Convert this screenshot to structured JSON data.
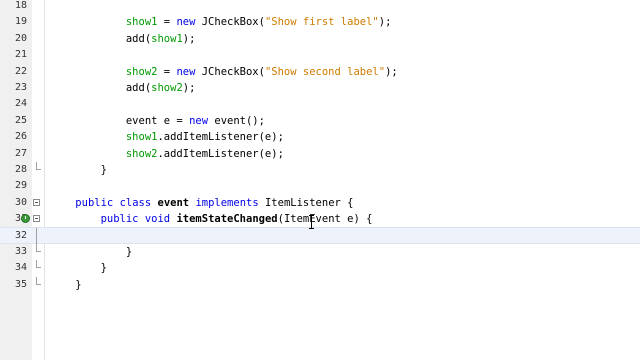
{
  "editor": {
    "lines": [
      {
        "num": "18",
        "indent": "",
        "tokens": [],
        "fold": "line"
      },
      {
        "num": "19",
        "indent": "            ",
        "fold": "line",
        "tokens": [
          {
            "t": "show1",
            "c": "fld"
          },
          {
            "t": " = "
          },
          {
            "t": "new",
            "c": "kw"
          },
          {
            "t": " JCheckBox("
          },
          {
            "t": "\"Show first label\"",
            "c": "str"
          },
          {
            "t": ");"
          }
        ]
      },
      {
        "num": "20",
        "indent": "            ",
        "fold": "line",
        "tokens": [
          {
            "t": "add("
          },
          {
            "t": "show1",
            "c": "fld"
          },
          {
            "t": ");"
          }
        ]
      },
      {
        "num": "21",
        "indent": "",
        "fold": "line",
        "tokens": []
      },
      {
        "num": "22",
        "indent": "            ",
        "fold": "line",
        "tokens": [
          {
            "t": "show2",
            "c": "fld"
          },
          {
            "t": " = "
          },
          {
            "t": "new",
            "c": "kw"
          },
          {
            "t": " JCheckBox("
          },
          {
            "t": "\"Show second label\"",
            "c": "str"
          },
          {
            "t": ");"
          }
        ]
      },
      {
        "num": "23",
        "indent": "            ",
        "fold": "line",
        "tokens": [
          {
            "t": "add("
          },
          {
            "t": "show2",
            "c": "fld"
          },
          {
            "t": ");"
          }
        ]
      },
      {
        "num": "24",
        "indent": "",
        "fold": "line",
        "tokens": []
      },
      {
        "num": "25",
        "indent": "            ",
        "fold": "line",
        "tokens": [
          {
            "t": "event e = "
          },
          {
            "t": "new",
            "c": "kw"
          },
          {
            "t": " event();"
          }
        ]
      },
      {
        "num": "26",
        "indent": "            ",
        "fold": "line",
        "tokens": [
          {
            "t": "show1",
            "c": "fld"
          },
          {
            "t": ".addItemListener(e);"
          }
        ]
      },
      {
        "num": "27",
        "indent": "            ",
        "fold": "line",
        "tokens": [
          {
            "t": "show2",
            "c": "fld"
          },
          {
            "t": ".addItemListener(e);"
          }
        ]
      },
      {
        "num": "28",
        "indent": "        ",
        "fold": "end",
        "tokens": [
          {
            "t": "}"
          }
        ]
      },
      {
        "num": "29",
        "indent": "",
        "fold": "line",
        "tokens": []
      },
      {
        "num": "30",
        "indent": "    ",
        "fold": "toggle",
        "tokens": [
          {
            "t": "public",
            "c": "kw"
          },
          {
            "t": " "
          },
          {
            "t": "class",
            "c": "kw"
          },
          {
            "t": " "
          },
          {
            "t": "event",
            "c": "bold"
          },
          {
            "t": " "
          },
          {
            "t": "implements",
            "c": "kw"
          },
          {
            "t": " ItemListener {"
          }
        ]
      },
      {
        "num": "31",
        "indent": "        ",
        "fold": "toggle",
        "impl": true,
        "tokens": [
          {
            "t": "public",
            "c": "kw"
          },
          {
            "t": " "
          },
          {
            "t": "void",
            "c": "kw"
          },
          {
            "t": " "
          },
          {
            "t": "itemStateChanged",
            "c": "bold"
          },
          {
            "t": "(ItemEvent e) {"
          }
        ]
      },
      {
        "num": "32",
        "indent": "",
        "fold": "line",
        "current": true,
        "tokens": []
      },
      {
        "num": "33",
        "indent": "            ",
        "fold": "end",
        "tokens": [
          {
            "t": "}"
          }
        ]
      },
      {
        "num": "34",
        "indent": "        ",
        "fold": "end",
        "tokens": [
          {
            "t": "}"
          }
        ]
      },
      {
        "num": "35",
        "indent": "    ",
        "fold": "end",
        "tokens": [
          {
            "t": "}"
          }
        ]
      }
    ]
  },
  "icons": {
    "fold_toggle": "collapse-minus-icon",
    "implements_marker": "implements-method-icon",
    "cursor": "text-cursor-icon"
  }
}
